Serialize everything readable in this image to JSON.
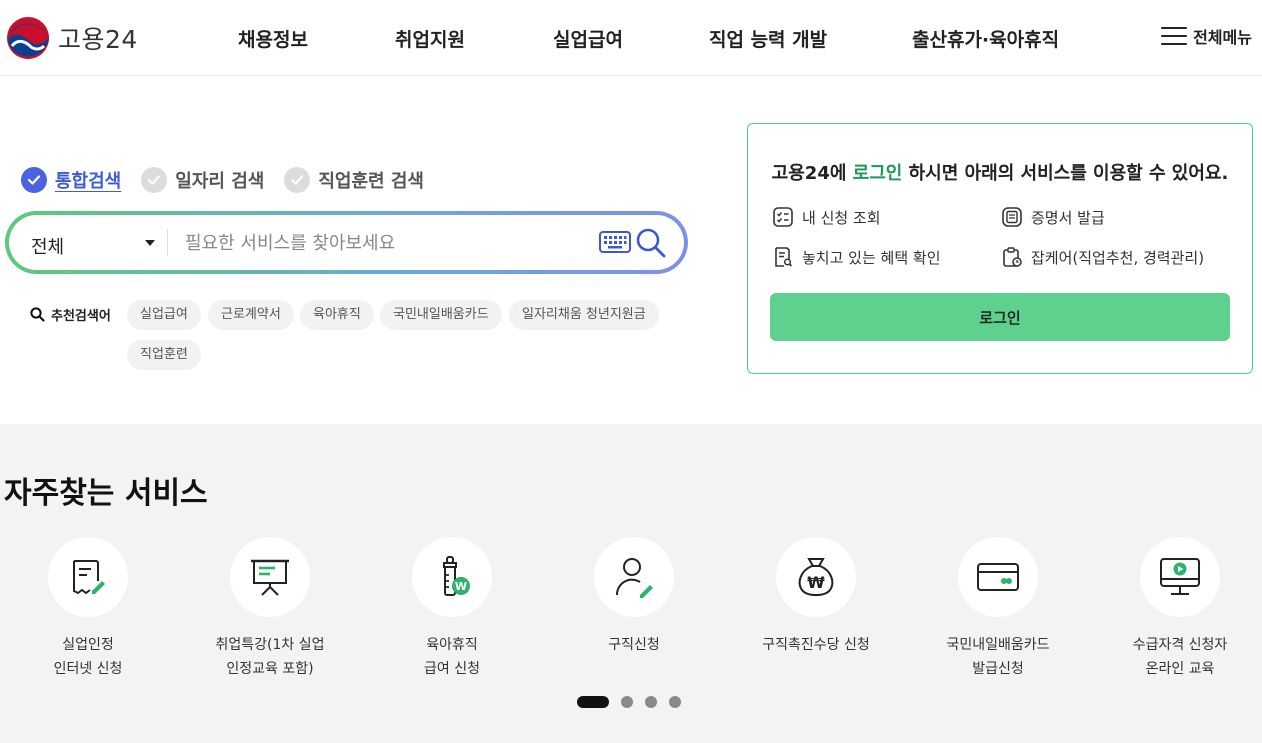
{
  "header": {
    "logo_text": "고용24",
    "nav": [
      "채용정보",
      "취업지원",
      "실업급여",
      "직업 능력 개발",
      "출산휴가·육아휴직"
    ],
    "menu_all": "전체메뉴"
  },
  "search": {
    "tabs": [
      {
        "label": "통합검색",
        "active": true
      },
      {
        "label": "일자리 검색",
        "active": false
      },
      {
        "label": "직업훈련 검색",
        "active": false
      }
    ],
    "select_value": "전체",
    "placeholder": "필요한 서비스를 찾아보세요",
    "recommend_label": "추천검색어",
    "keywords": [
      "실업급여",
      "근로계약서",
      "육아휴직",
      "국민내일배움카드",
      "일자리채움 청년지원금",
      "직업훈련"
    ]
  },
  "login": {
    "title_pre": "고용24에 ",
    "title_hl": "로그인",
    "title_post": " 하시면 아래의 서비스를 이용할 수 있어요.",
    "services": [
      "내 신청 조회",
      "증명서 발급",
      "놓치고 있는 혜택 확인",
      "잡케어(직업추천, 경력관리)"
    ],
    "button": "로그인",
    "accent": "#5fd18e",
    "highlight": "#1a9a56"
  },
  "frequent": {
    "title": "자주찾는 서비스",
    "items": [
      {
        "line1": "실업인정",
        "line2": "인터넷 신청",
        "icon": "document-pen-icon"
      },
      {
        "line1": "취업특강(1차 실업",
        "line2": "인정교육 포함)",
        "icon": "presentation-board-icon"
      },
      {
        "line1": "육아휴직",
        "line2": "급여 신청",
        "icon": "baby-bottle-icon"
      },
      {
        "line1": "구직신청",
        "line2": "",
        "icon": "person-pen-icon"
      },
      {
        "line1": "구직촉진수당 신청",
        "line2": "",
        "icon": "money-bag-icon"
      },
      {
        "line1": "국민내일배움카드",
        "line2": "발급신청",
        "icon": "card-icon"
      },
      {
        "line1": "수급자격 신청자",
        "line2": "온라인 교육",
        "icon": "monitor-play-icon"
      }
    ],
    "pagination": {
      "pages": 4,
      "current": 1
    }
  }
}
